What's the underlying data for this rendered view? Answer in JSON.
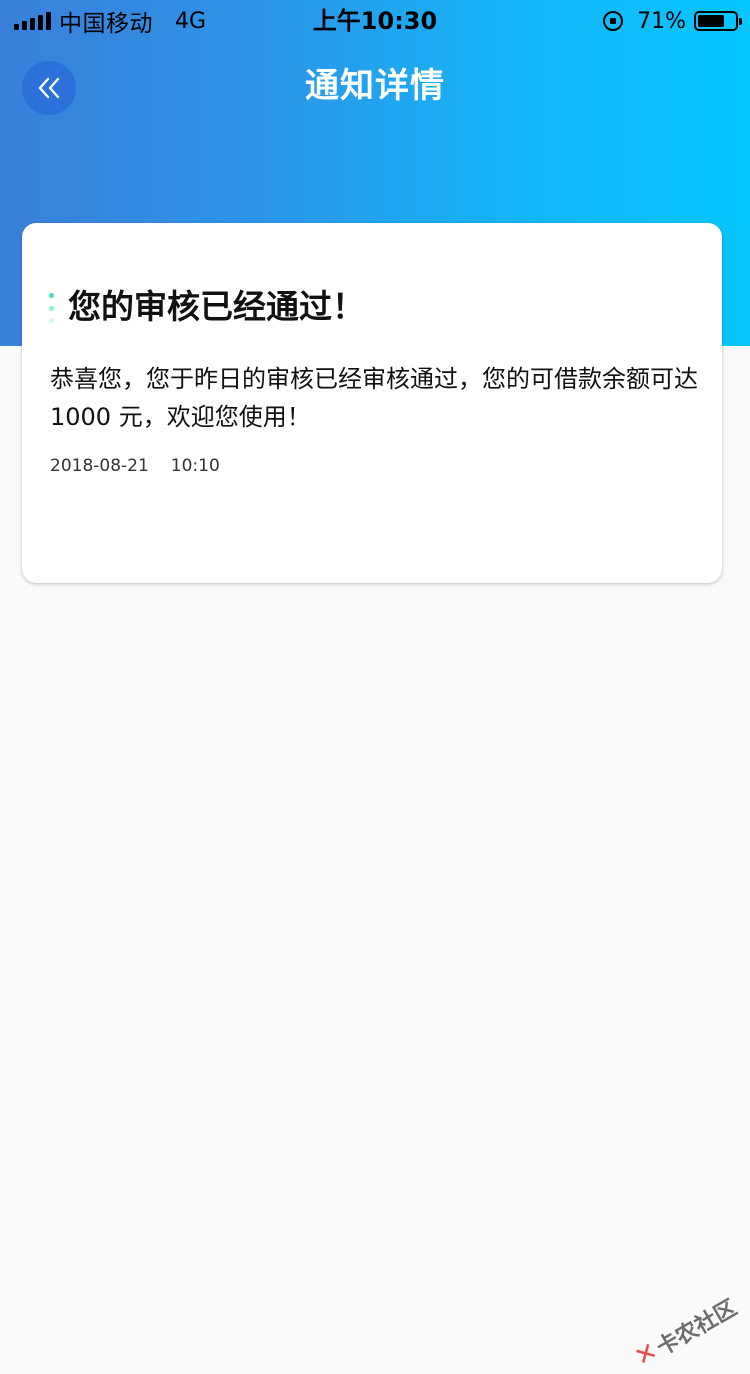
{
  "status_bar": {
    "carrier": "中国移动",
    "network": "4G",
    "time": "上午10:30",
    "battery_percent": "71%",
    "battery_level": 0.71
  },
  "nav": {
    "title": "通知详情",
    "back_icon": "double-chevron-left-icon"
  },
  "notification": {
    "title": "您的审核已经通过！",
    "body": "恭喜您，您于昨日的审核已经审核通过，您的可借款余额可达 1000 元，欢迎您使用！",
    "date": "2018-08-21",
    "time": "10:10"
  },
  "watermark": {
    "text": "卡农社区"
  },
  "colors": {
    "header_gradient_start": "#3a7fd9",
    "header_gradient_end": "#06c6fd",
    "back_button": "#2b6fd8",
    "marker_accent": "#3ddfc0",
    "page_background": "#fafafa"
  }
}
